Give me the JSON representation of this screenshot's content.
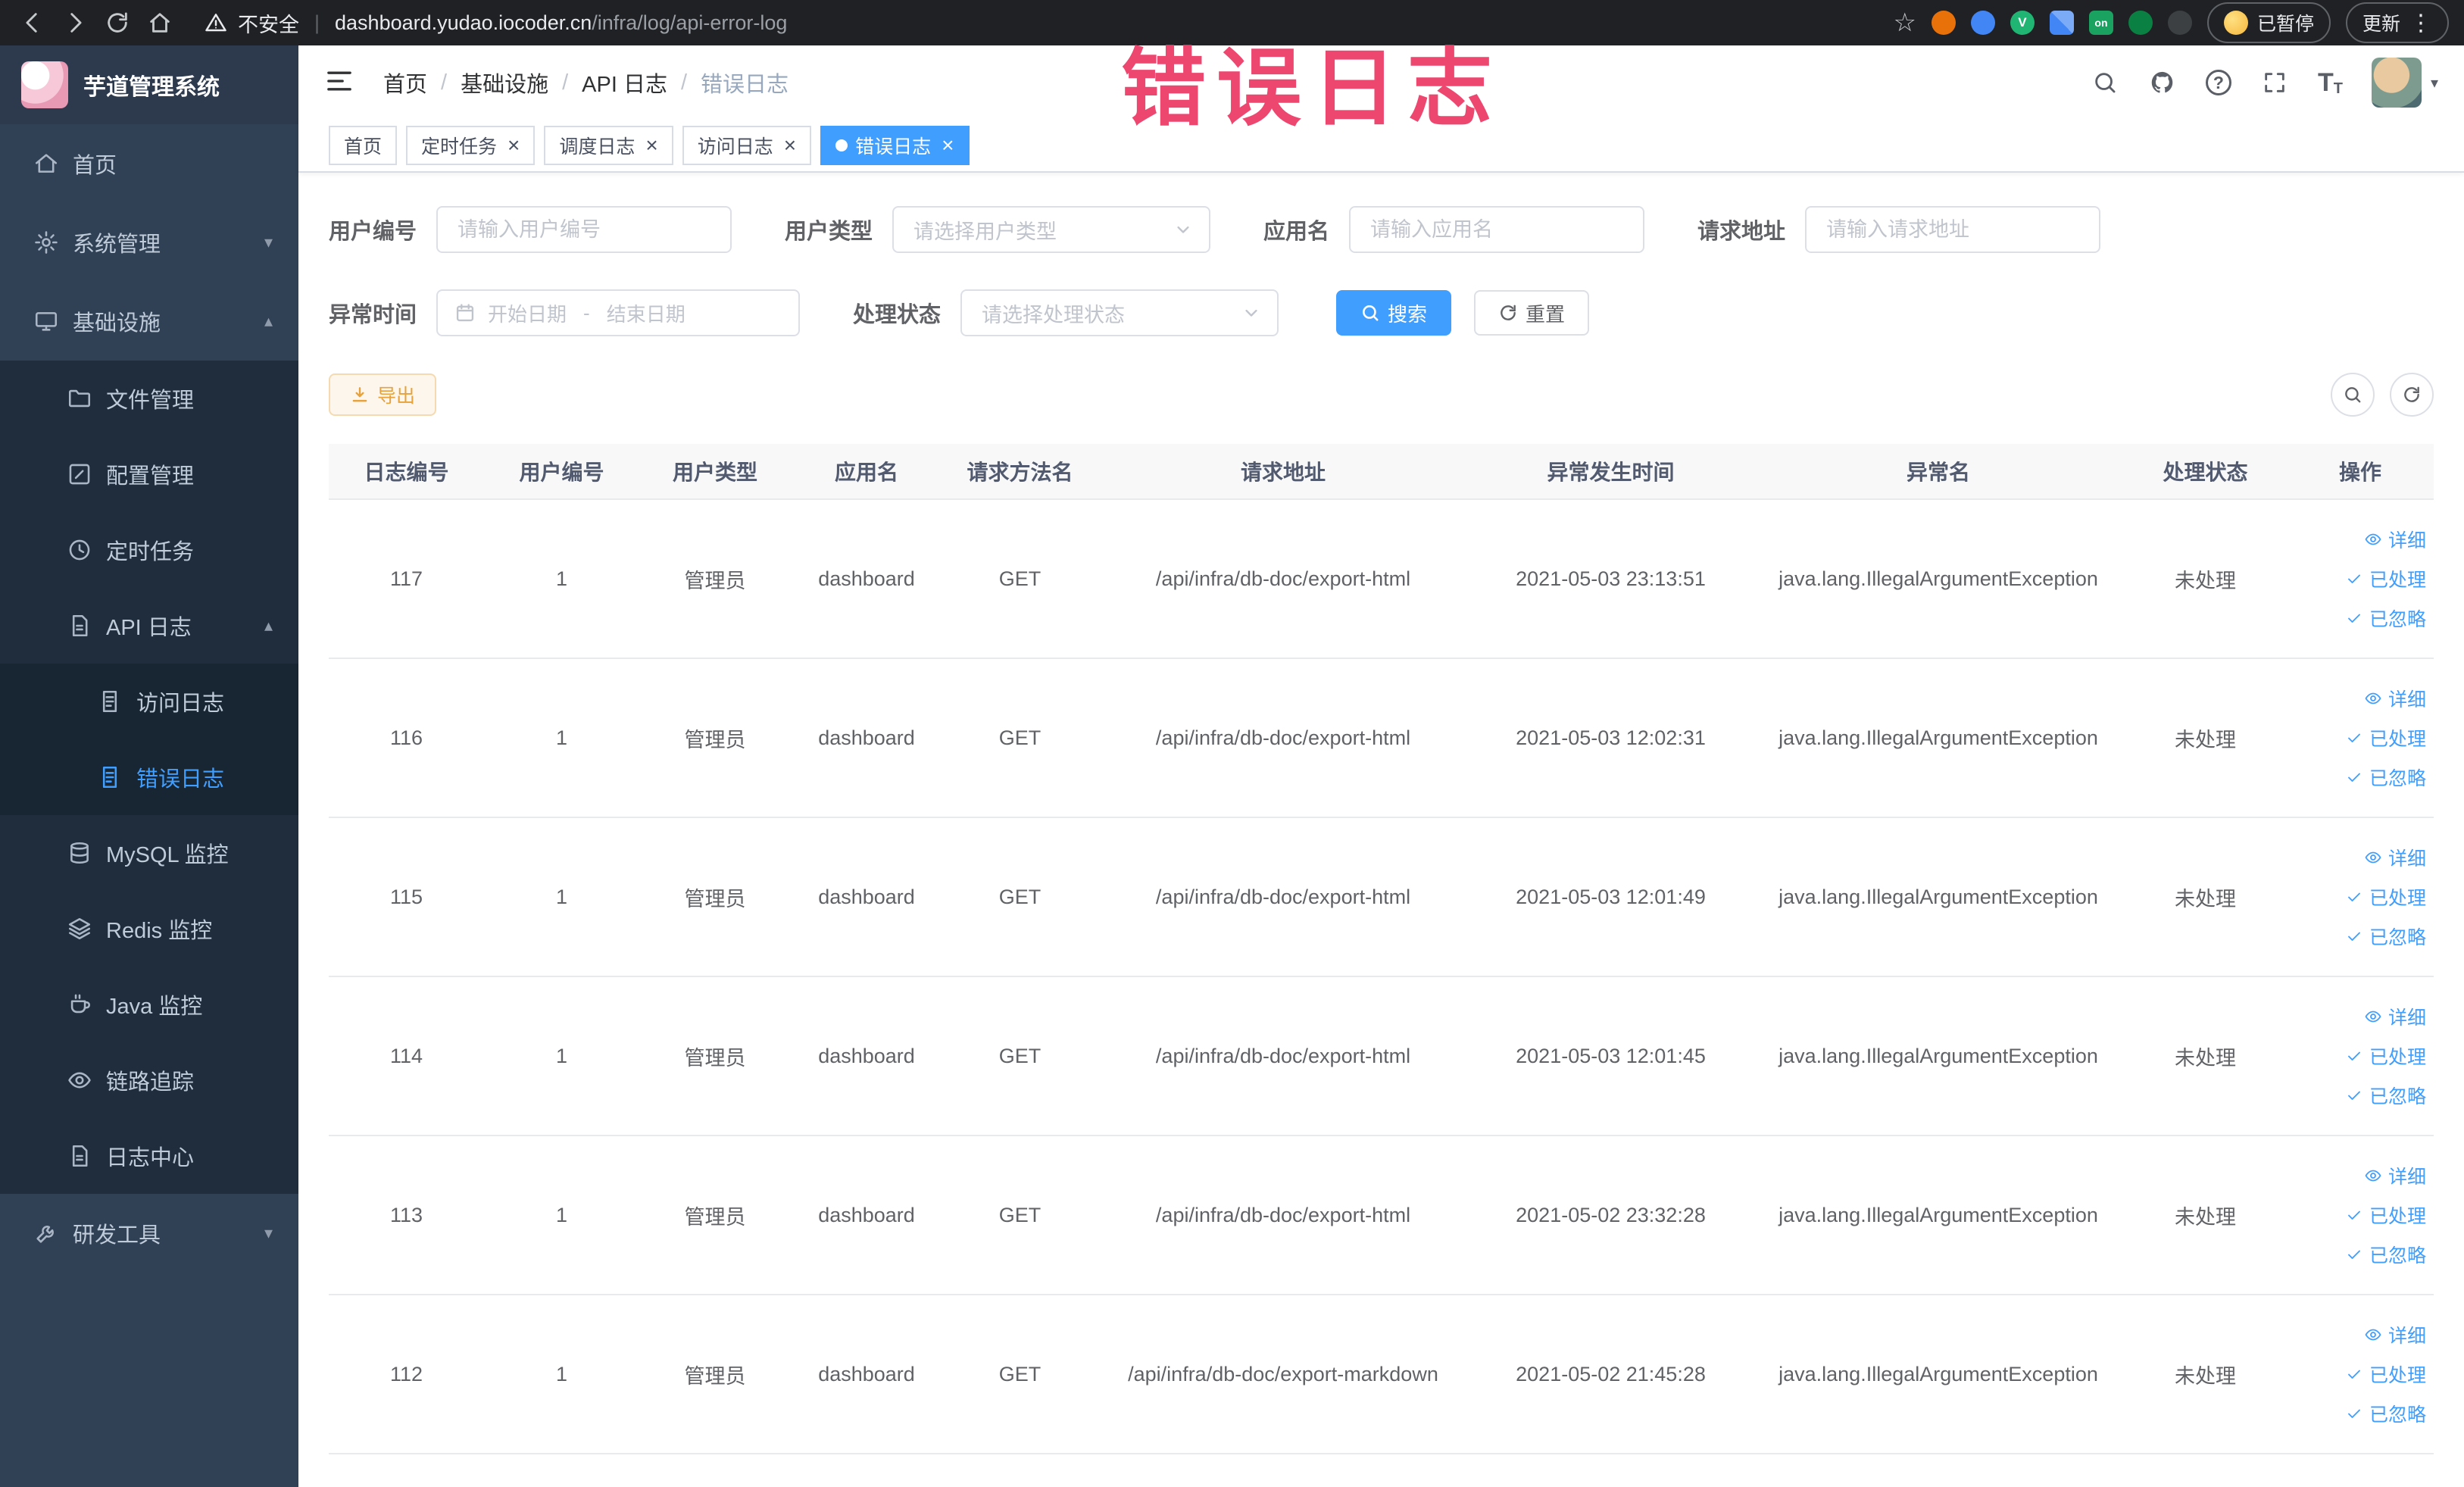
{
  "browser": {
    "security_label": "不安全",
    "url_host": "dashboard.yudao.iocoder.cn",
    "url_path": "/infra/log/api-error-log",
    "paused_label": "已暂停",
    "update_label": "更新",
    "on_badge": "on"
  },
  "annotation": "错误日志",
  "sidebar": {
    "title": "芋道管理系统",
    "items": [
      {
        "id": "home",
        "label": "首页",
        "level": 0,
        "icon": "home"
      },
      {
        "id": "system",
        "label": "系统管理",
        "level": 0,
        "icon": "gear",
        "chevron": "down"
      },
      {
        "id": "infrastructure",
        "label": "基础设施",
        "level": 0,
        "icon": "monitor",
        "chevron": "up"
      },
      {
        "id": "file",
        "label": "文件管理",
        "level": 1,
        "icon": "folder"
      },
      {
        "id": "config",
        "label": "配置管理",
        "level": 1,
        "icon": "edit"
      },
      {
        "id": "job",
        "label": "定时任务",
        "level": 1,
        "icon": "clock"
      },
      {
        "id": "api-log",
        "label": "API 日志",
        "level": 1,
        "icon": "doc",
        "chevron": "up"
      },
      {
        "id": "access-log",
        "label": "访问日志",
        "level": 2,
        "icon": "doc2"
      },
      {
        "id": "error-log",
        "label": "错误日志",
        "level": 2,
        "icon": "doc2",
        "active": true
      },
      {
        "id": "mysql",
        "label": "MySQL 监控",
        "level": 1,
        "icon": "db"
      },
      {
        "id": "redis",
        "label": "Redis 监控",
        "level": 1,
        "icon": "layers"
      },
      {
        "id": "java",
        "label": "Java 监控",
        "level": 1,
        "icon": "coffee"
      },
      {
        "id": "trace",
        "label": "链路追踪",
        "level": 1,
        "icon": "eye"
      },
      {
        "id": "log-center",
        "label": "日志中心",
        "level": 1,
        "icon": "doc"
      },
      {
        "id": "devtools",
        "label": "研发工具",
        "level": 0,
        "icon": "tool",
        "chevron": "down"
      }
    ]
  },
  "breadcrumb": [
    "首页",
    "基础设施",
    "API 日志",
    "错误日志"
  ],
  "tabs": [
    {
      "id": "home",
      "label": "首页",
      "closable": false,
      "active": false
    },
    {
      "id": "job",
      "label": "定时任务",
      "closable": true,
      "active": false
    },
    {
      "id": "job-log",
      "label": "调度日志",
      "closable": true,
      "active": false
    },
    {
      "id": "access-log",
      "label": "访问日志",
      "closable": true,
      "active": false
    },
    {
      "id": "error-log",
      "label": "错误日志",
      "closable": true,
      "active": true
    }
  ],
  "filters": {
    "user_id_label": "用户编号",
    "user_id_placeholder": "请输入用户编号",
    "user_id_value": "",
    "user_type_label": "用户类型",
    "user_type_placeholder": "请选择用户类型",
    "app_name_label": "应用名",
    "app_name_placeholder": "请输入应用名",
    "app_name_value": "",
    "request_url_label": "请求地址",
    "request_url_placeholder": "请输入请求地址",
    "request_url_value": "",
    "time_label": "异常时间",
    "time_start_placeholder": "开始日期",
    "time_separator": "-",
    "time_end_placeholder": "结束日期",
    "status_label": "处理状态",
    "status_placeholder": "请选择处理状态",
    "search_label": "搜索",
    "reset_label": "重置"
  },
  "toolbar": {
    "export_label": "导出"
  },
  "table": {
    "columns": [
      "日志编号",
      "用户编号",
      "用户类型",
      "应用名",
      "请求方法名",
      "请求地址",
      "异常发生时间",
      "异常名",
      "处理状态",
      "操作"
    ],
    "row_actions": [
      "详细",
      "已处理",
      "已忽略"
    ],
    "rows": [
      {
        "log_id": "117",
        "user_id": "1",
        "user_type": "管理员",
        "app_name": "dashboard",
        "method": "GET",
        "url": "/api/infra/db-doc/export-html",
        "time": "2021-05-03 23:13:51",
        "exception": "java.lang.IllegalArgumentException",
        "status": "未处理"
      },
      {
        "log_id": "116",
        "user_id": "1",
        "user_type": "管理员",
        "app_name": "dashboard",
        "method": "GET",
        "url": "/api/infra/db-doc/export-html",
        "time": "2021-05-03 12:02:31",
        "exception": "java.lang.IllegalArgumentException",
        "status": "未处理"
      },
      {
        "log_id": "115",
        "user_id": "1",
        "user_type": "管理员",
        "app_name": "dashboard",
        "method": "GET",
        "url": "/api/infra/db-doc/export-html",
        "time": "2021-05-03 12:01:49",
        "exception": "java.lang.IllegalArgumentException",
        "status": "未处理"
      },
      {
        "log_id": "114",
        "user_id": "1",
        "user_type": "管理员",
        "app_name": "dashboard",
        "method": "GET",
        "url": "/api/infra/db-doc/export-html",
        "time": "2021-05-03 12:01:45",
        "exception": "java.lang.IllegalArgumentException",
        "status": "未处理"
      },
      {
        "log_id": "113",
        "user_id": "1",
        "user_type": "管理员",
        "app_name": "dashboard",
        "method": "GET",
        "url": "/api/infra/db-doc/export-html",
        "time": "2021-05-02 23:32:28",
        "exception": "java.lang.IllegalArgumentException",
        "status": "未处理"
      },
      {
        "log_id": "112",
        "user_id": "1",
        "user_type": "管理员",
        "app_name": "dashboard",
        "method": "GET",
        "url": "/api/infra/db-doc/export-markdown",
        "time": "2021-05-02 21:45:28",
        "exception": "java.lang.IllegalArgumentException",
        "status": "未处理"
      }
    ]
  }
}
